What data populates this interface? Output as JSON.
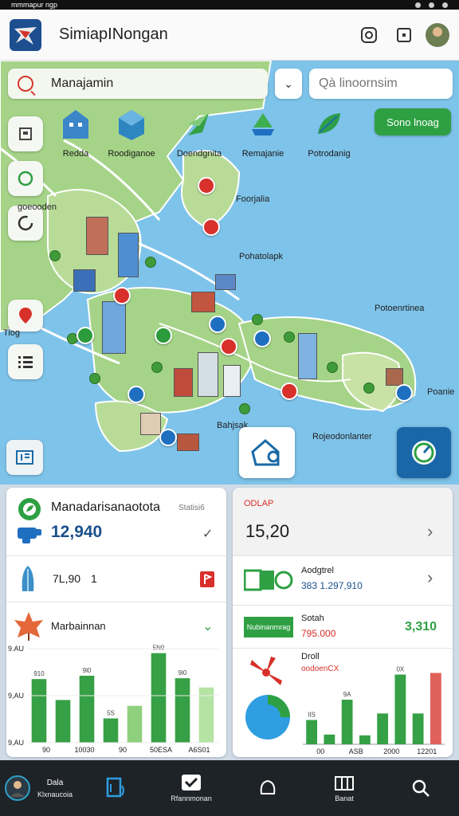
{
  "status_bar": {
    "left_text": "mmmapur ngp"
  },
  "header": {
    "title": "SimiapINongan",
    "icons": [
      "instagram-icon",
      "square-icon",
      "avatar"
    ]
  },
  "map": {
    "search": {
      "value": "Manajamin",
      "secondary_placeholder": "Qà linoornsim"
    },
    "green_button": "Sono lnoag",
    "categories": [
      {
        "icon": "building-icon",
        "label": "Redda"
      },
      {
        "icon": "cube-icon",
        "label": "Roodiganoe"
      },
      {
        "icon": "leaf-plane-icon",
        "label": "Doendgnita"
      },
      {
        "icon": "ship-icon",
        "label": "Remajanie"
      },
      {
        "icon": "leaf-icon",
        "label": "Potrodanig"
      }
    ],
    "labels": {
      "north_left": "goeooden",
      "center_top": "Foorjalia",
      "center": "Pohatolapk",
      "east": "Potoenrtinea",
      "far_east": "Poanie",
      "side_tag": "Tiog",
      "south_center": "Bahjsak",
      "south_right": "Rojeodonlanter"
    },
    "colors": {
      "water": "#7ec3ea",
      "land": "#a5d488",
      "accent_green": "#2ea043",
      "accent_blue": "#1a67a8"
    }
  },
  "panel_left": {
    "header": {
      "title": "Manadarisanaotota",
      "tag": "Statisi6",
      "value": "12,940"
    },
    "row2": {
      "value": "7L,90",
      "count": "1"
    },
    "row3": {
      "title": "Marbainnan"
    },
    "chart_data": {
      "type": "bar",
      "ylabels": [
        "9.AU",
        "9,AU",
        "9,AU"
      ],
      "categories": [
        "90",
        "10030",
        "90",
        "50ESA",
        "A6S01"
      ],
      "values": [
        76,
        51,
        80,
        29,
        44,
        107,
        77,
        66
      ],
      "data_labels": [
        "910",
        "",
        "9l0",
        "5S",
        "",
        "5N0",
        "9l0",
        ""
      ]
    }
  },
  "panel_right": {
    "header": {
      "tag": "ODLAP",
      "value": "15,20"
    },
    "row2": {
      "title": "Aodgtrel",
      "value": "383 1.297,910"
    },
    "row3": {
      "chip": "Nubinanrnrag",
      "title": "Sotah",
      "value": "795.000",
      "right_value": "3,310"
    },
    "row4": {
      "title": "Droll",
      "subtitle": "oodoenCX"
    },
    "chart_data": {
      "type": "bar",
      "categories": [
        "00",
        "ASB",
        "2000",
        "12201"
      ],
      "values": [
        30,
        12,
        55,
        11,
        38,
        86,
        38,
        88
      ],
      "data_labels": [
        "lIS",
        "",
        "9A",
        "",
        "",
        "0X",
        "",
        ""
      ]
    }
  },
  "bottom_nav": [
    {
      "icon": "user-avatar",
      "label": "Dala",
      "sub": "Klxnaucoia"
    },
    {
      "icon": "document-icon",
      "label": "",
      "sub": ""
    },
    {
      "icon": "check-mail-icon",
      "label": "",
      "sub": "Rfannmonan"
    },
    {
      "icon": "pin-icon",
      "label": "",
      "sub": ""
    },
    {
      "icon": "map-icon",
      "label": "",
      "sub": "Banat"
    },
    {
      "icon": "search-icon",
      "label": "",
      "sub": ""
    }
  ]
}
